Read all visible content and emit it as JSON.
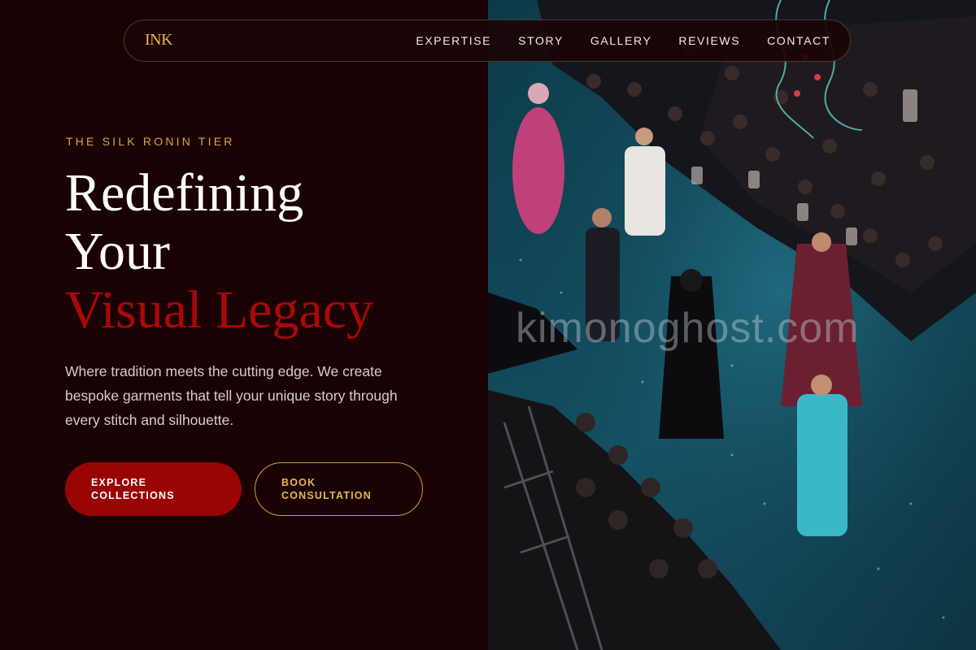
{
  "nav": {
    "logo": "INK",
    "links": [
      "EXPERTISE",
      "STORY",
      "GALLERY",
      "REVIEWS",
      "CONTACT"
    ]
  },
  "hero": {
    "eyebrow": "THE SILK RONIN TIER",
    "headline_line1": "Redefining",
    "headline_line2": "Your",
    "headline_accent": "Visual Legacy",
    "description": "Where tradition meets the cutting edge. We create bespoke garments that tell your unique story through every stitch and silhouette.",
    "primary_button": [
      "EXPLORE",
      "COLLECTIONS"
    ],
    "secondary_button": [
      "BOOK",
      "CONSULTATION"
    ]
  },
  "image": {
    "watermark": "kimonoghost.com"
  },
  "colors": {
    "background": "#1a0204",
    "accent_red": "#a80808",
    "gold": "#e8b84a",
    "button_red": "#9a0404"
  }
}
